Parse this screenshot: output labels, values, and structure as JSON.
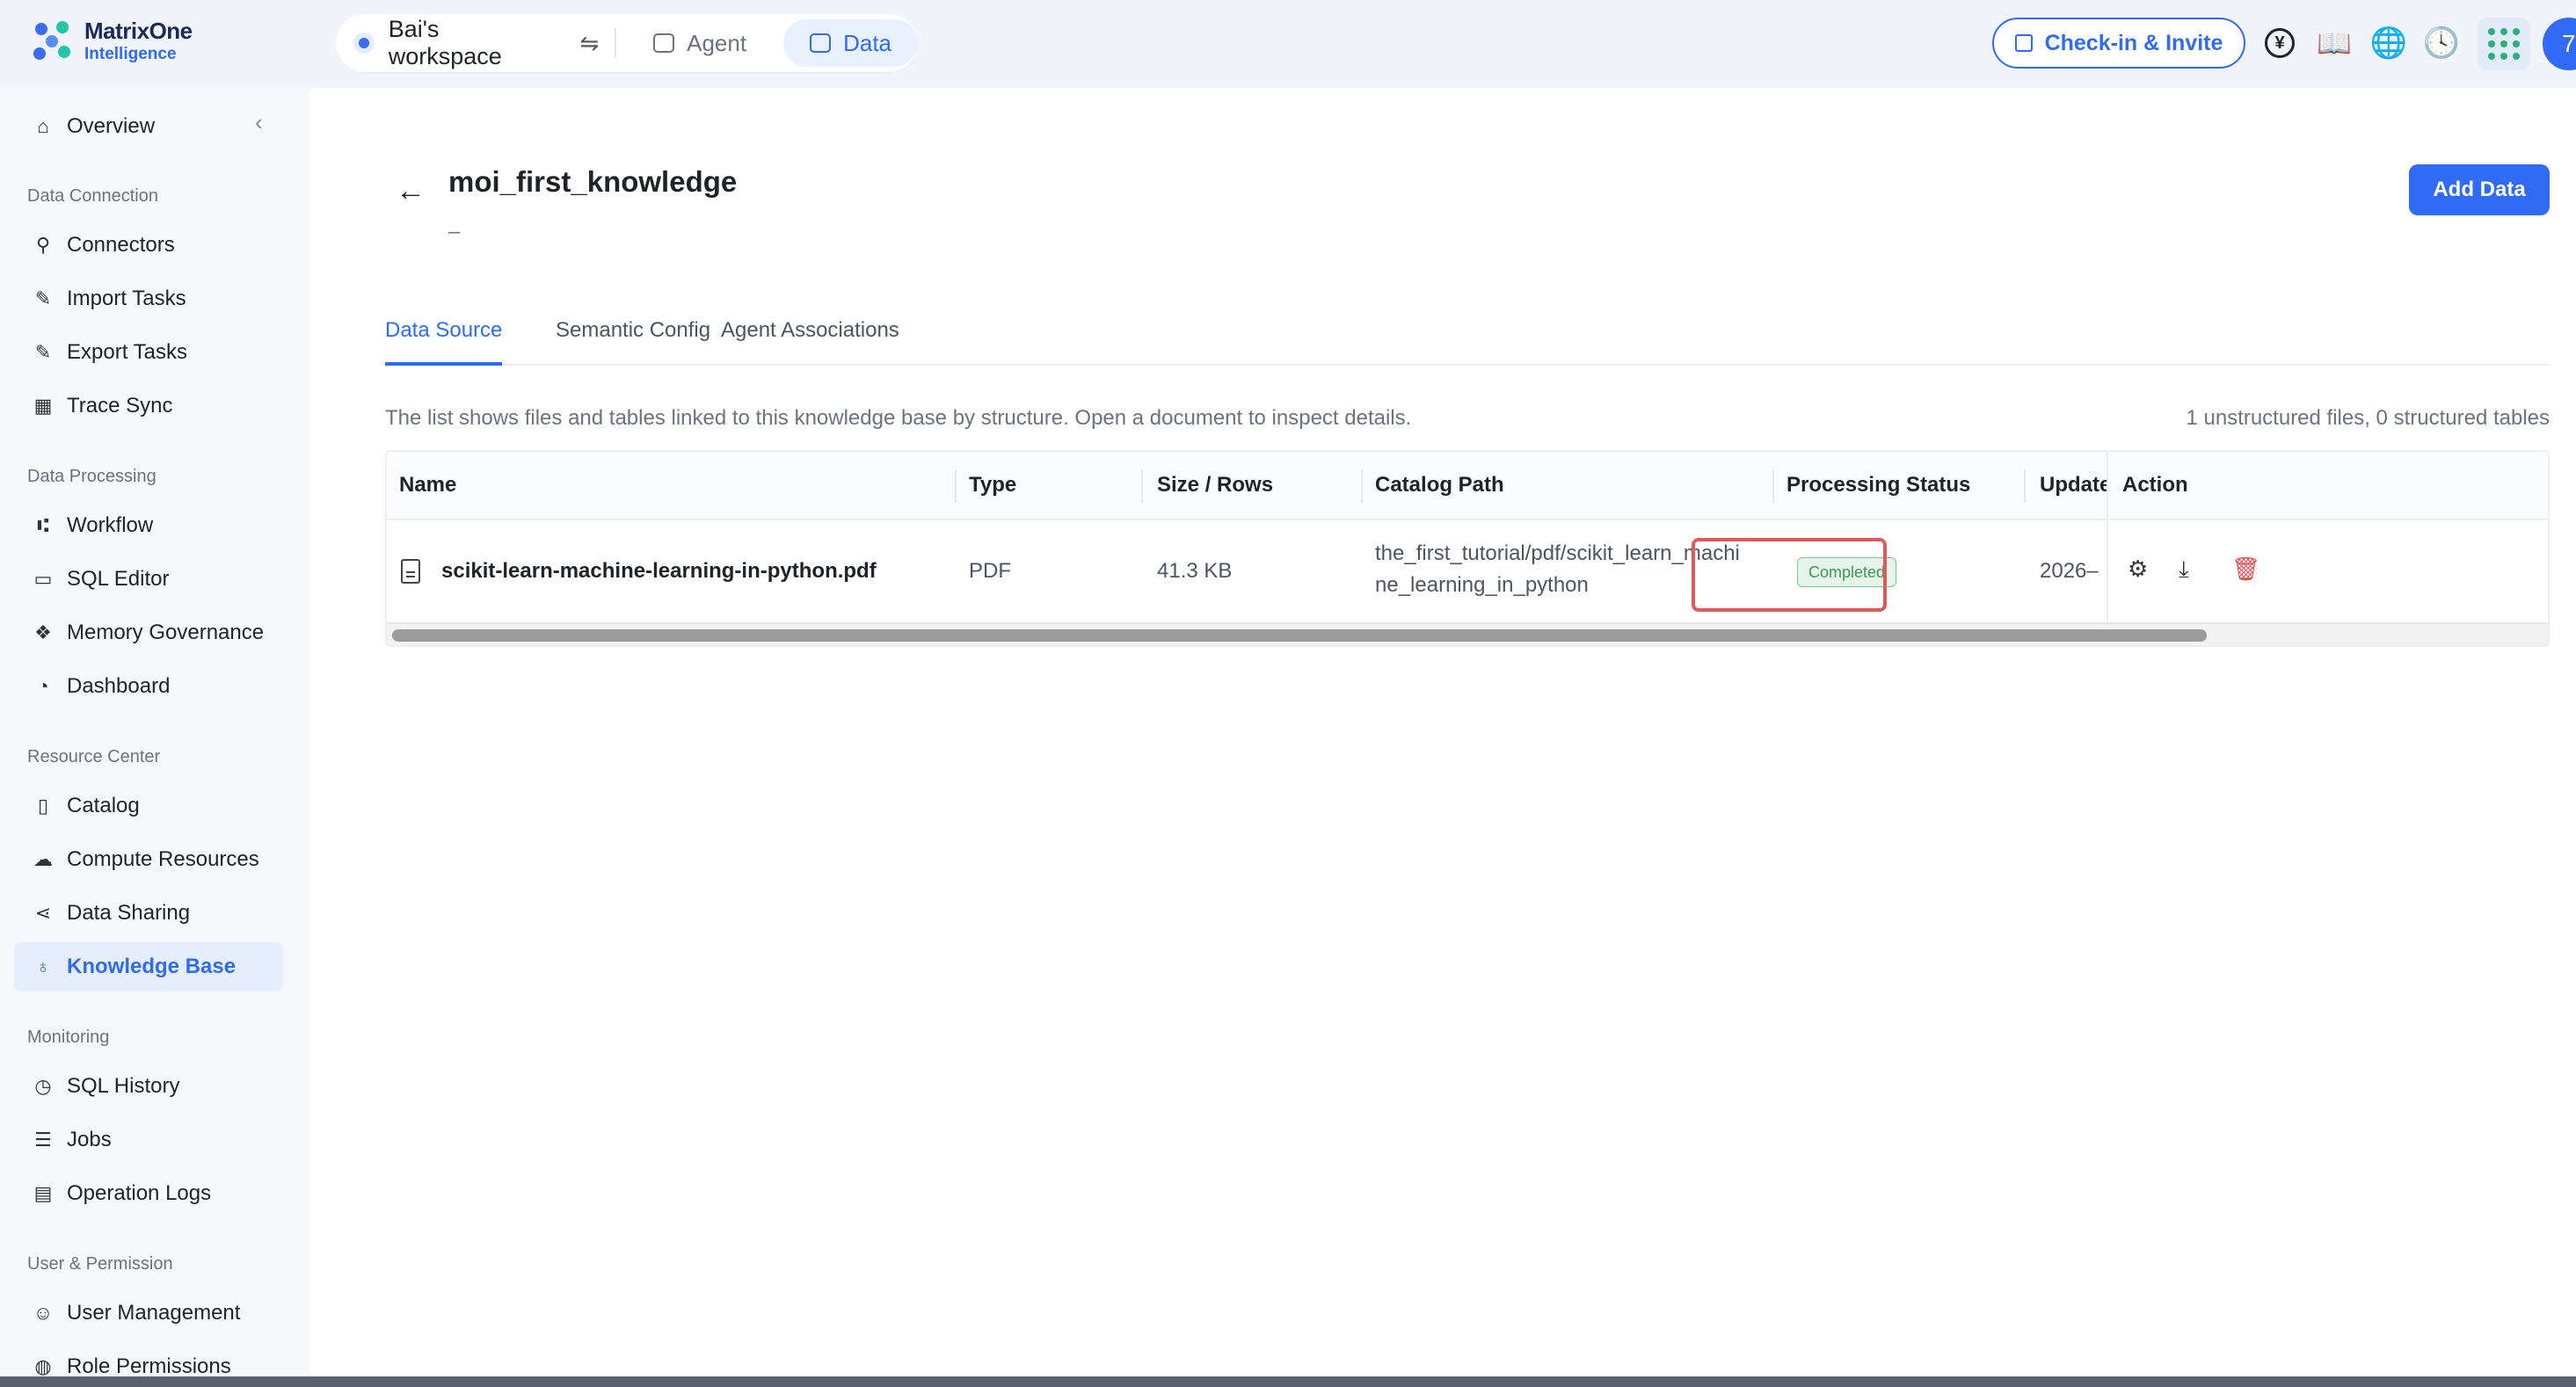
{
  "logo": {
    "line1": "MatrixOne",
    "line2": "Intelligence"
  },
  "workspace": {
    "name": "Bai's workspace",
    "swap_icon": "swap-icon"
  },
  "top_nav": {
    "agent_label": "Agent",
    "data_label": "Data",
    "active": "Data"
  },
  "header_actions": {
    "checkin_label": "Check-in & Invite",
    "icons": [
      "yen-icon",
      "book-icon",
      "globe-icon",
      "clock-icon",
      "apps-grid-icon"
    ],
    "avatar_initial": "7"
  },
  "sidebar": {
    "overview": "Overview",
    "groups": [
      {
        "title": "Data Connection",
        "items": [
          "Connectors",
          "Import Tasks",
          "Export Tasks",
          "Trace Sync"
        ]
      },
      {
        "title": "Data Processing",
        "items": [
          "Workflow",
          "SQL Editor",
          "Memory Governance",
          "Dashboard"
        ]
      },
      {
        "title": "Resource Center",
        "items": [
          "Catalog",
          "Compute Resources",
          "Data Sharing",
          "Knowledge Base"
        ]
      },
      {
        "title": "Monitoring",
        "items": [
          "SQL History",
          "Jobs",
          "Operation Logs"
        ]
      },
      {
        "title": "User & Permission",
        "items": [
          "User Management",
          "Role Permissions"
        ]
      }
    ],
    "active_item": "Knowledge Base"
  },
  "page": {
    "title": "moi_first_knowledge",
    "description": "–",
    "add_button": "Add Data",
    "tabs": [
      "Data Source",
      "Semantic Config",
      "Agent Associations"
    ],
    "active_tab": "Data Source",
    "info_text": "The list shows files and tables linked to this knowledge base by structure. Open a document to inspect details.",
    "count_text": "1 unstructured files, 0 structured tables"
  },
  "table": {
    "columns": [
      "Name",
      "Type",
      "Size / Rows",
      "Catalog Path",
      "Processing Status",
      "Update",
      "Action"
    ],
    "rows": [
      {
        "name": "scikit-learn-machine-learning-in-python.pdf",
        "type": "PDF",
        "size": "41.3 KB",
        "path_line1": "the_first_tutorial/pdf/scikit_learn_machi",
        "path_line2": "ne_learning_in_python",
        "status": "Completed",
        "updated": "2026–"
      }
    ],
    "row_actions": [
      "settings-icon",
      "download-icon",
      "delete-icon"
    ],
    "status_color": "#3a9a57",
    "highlight_color": "#e05a5a"
  }
}
